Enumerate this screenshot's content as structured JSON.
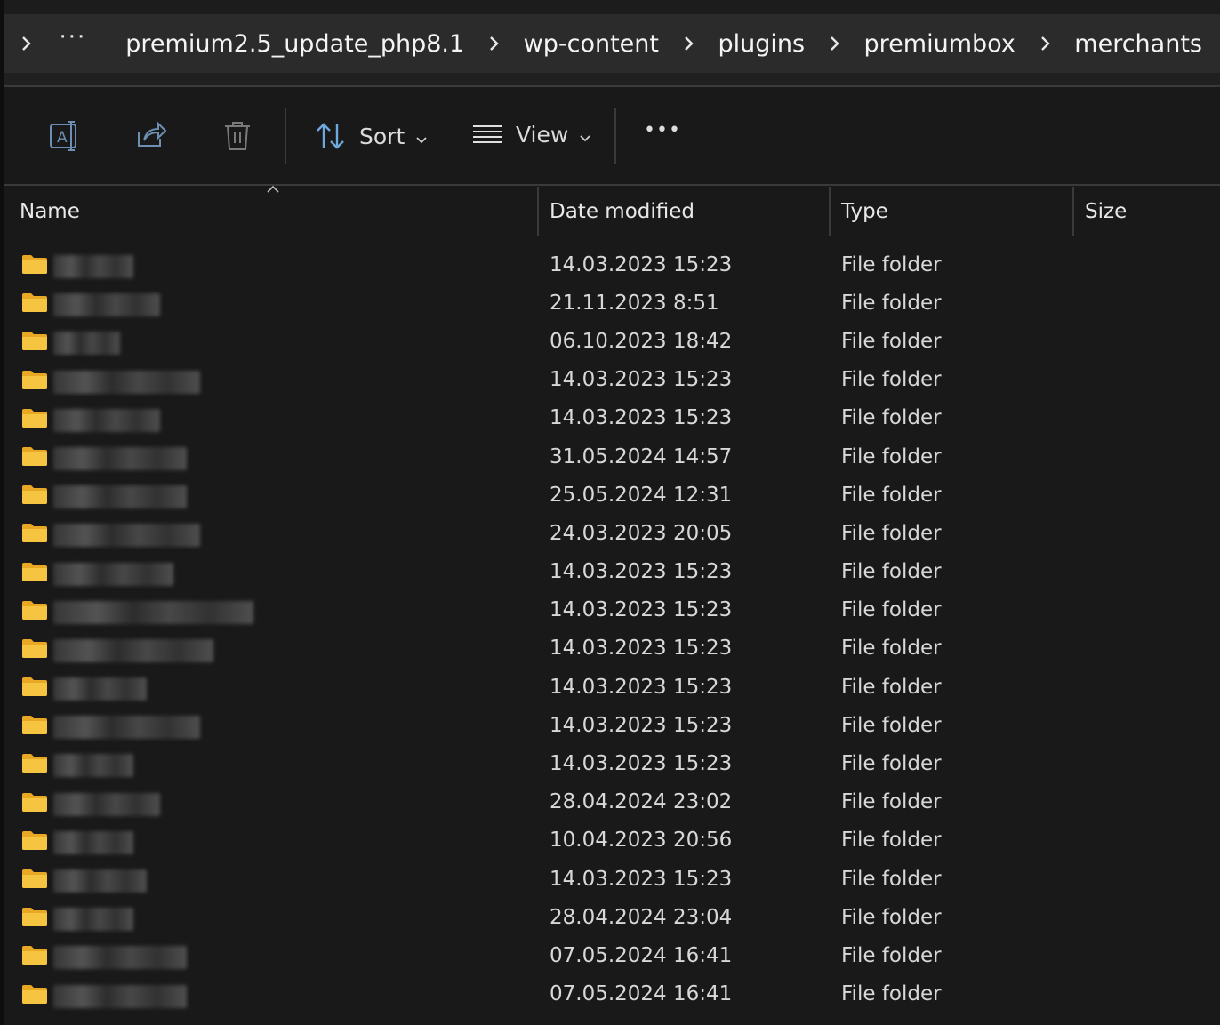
{
  "breadcrumb": {
    "overflow_label": "···",
    "items": [
      "premium2.5_update_php8.1",
      "wp-content",
      "plugins",
      "premiumbox",
      "merchants"
    ]
  },
  "toolbar": {
    "sort_label": "Sort",
    "view_label": "View",
    "more_label": "•••",
    "icons": [
      "rename-icon",
      "share-icon",
      "delete-icon",
      "sort-icon",
      "view-icon",
      "more-icon"
    ]
  },
  "columns": {
    "name": "Name",
    "date_modified": "Date modified",
    "type": "Type",
    "size": "Size"
  },
  "colors": {
    "background": "#191919",
    "address_bar": "#2b2b2b",
    "folder": "#f5c542",
    "text": "#d8d8d8"
  },
  "rows": [
    {
      "name_hidden": true,
      "date": "14.03.2023 15:23",
      "type": "File folder",
      "size": ""
    },
    {
      "name_hidden": true,
      "date": "21.11.2023 8:51",
      "type": "File folder",
      "size": ""
    },
    {
      "name_hidden": true,
      "date": "06.10.2023 18:42",
      "type": "File folder",
      "size": ""
    },
    {
      "name_hidden": true,
      "date": "14.03.2023 15:23",
      "type": "File folder",
      "size": ""
    },
    {
      "name_hidden": true,
      "date": "14.03.2023 15:23",
      "type": "File folder",
      "size": ""
    },
    {
      "name_hidden": true,
      "date": "31.05.2024 14:57",
      "type": "File folder",
      "size": ""
    },
    {
      "name_hidden": true,
      "date": "25.05.2024 12:31",
      "type": "File folder",
      "size": ""
    },
    {
      "name_hidden": true,
      "date": "24.03.2023 20:05",
      "type": "File folder",
      "size": ""
    },
    {
      "name_hidden": true,
      "date": "14.03.2023 15:23",
      "type": "File folder",
      "size": ""
    },
    {
      "name_hidden": true,
      "date": "14.03.2023 15:23",
      "type": "File folder",
      "size": ""
    },
    {
      "name_hidden": true,
      "date": "14.03.2023 15:23",
      "type": "File folder",
      "size": ""
    },
    {
      "name_hidden": true,
      "date": "14.03.2023 15:23",
      "type": "File folder",
      "size": ""
    },
    {
      "name_hidden": true,
      "date": "14.03.2023 15:23",
      "type": "File folder",
      "size": ""
    },
    {
      "name_hidden": true,
      "date": "14.03.2023 15:23",
      "type": "File folder",
      "size": ""
    },
    {
      "name_hidden": true,
      "date": "28.04.2024 23:02",
      "type": "File folder",
      "size": ""
    },
    {
      "name_hidden": true,
      "date": "10.04.2023 20:56",
      "type": "File folder",
      "size": ""
    },
    {
      "name_hidden": true,
      "date": "14.03.2023 15:23",
      "type": "File folder",
      "size": ""
    },
    {
      "name_hidden": true,
      "date": "28.04.2024 23:04",
      "type": "File folder",
      "size": ""
    },
    {
      "name_hidden": true,
      "date": "07.05.2024 16:41",
      "type": "File folder",
      "size": ""
    },
    {
      "name_hidden": true,
      "date": "07.05.2024 16:41",
      "type": "File folder",
      "size": ""
    }
  ]
}
